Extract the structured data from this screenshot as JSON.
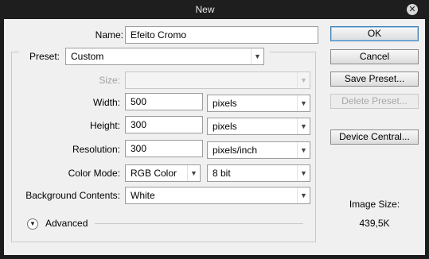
{
  "window": {
    "title": "New"
  },
  "form": {
    "name": {
      "label": "Name:",
      "value": "Efeito Cromo"
    },
    "preset": {
      "label": "Preset:",
      "value": "Custom"
    },
    "size": {
      "label": "Size:",
      "value": ""
    },
    "width": {
      "label": "Width:",
      "value": "500",
      "unit": "pixels"
    },
    "height": {
      "label": "Height:",
      "value": "300",
      "unit": "pixels"
    },
    "resolution": {
      "label": "Resolution:",
      "value": "300",
      "unit": "pixels/inch"
    },
    "color_mode": {
      "label": "Color Mode:",
      "mode": "RGB Color",
      "depth": "8 bit"
    },
    "background": {
      "label": "Background Contents:",
      "value": "White"
    },
    "advanced": {
      "label": "Advanced"
    }
  },
  "buttons": {
    "ok": "OK",
    "cancel": "Cancel",
    "save_preset": "Save Preset...",
    "delete_preset": "Delete Preset...",
    "device_central": "Device Central..."
  },
  "image_size": {
    "label": "Image Size:",
    "value": "439,5K"
  }
}
